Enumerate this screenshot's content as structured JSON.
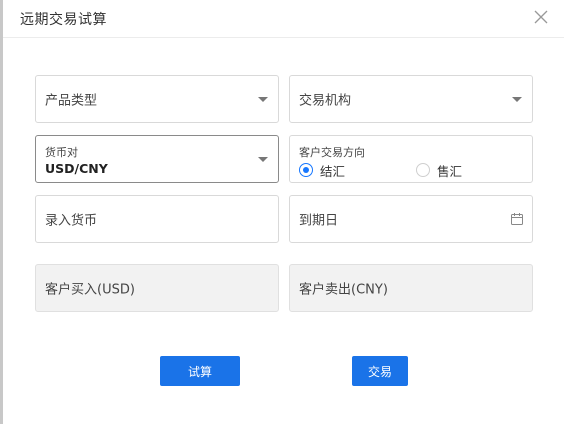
{
  "dialog": {
    "title": "远期交易试算",
    "close_icon": "close-icon"
  },
  "form": {
    "product_type": {
      "placeholder": "产品类型"
    },
    "trading_institution": {
      "placeholder": "交易机构"
    },
    "currency_pair": {
      "label": "货币对",
      "value": "USD/CNY"
    },
    "direction": {
      "label": "客户交易方向",
      "options": [
        {
          "label": "结汇",
          "checked": true
        },
        {
          "label": "售汇",
          "checked": false
        }
      ]
    },
    "input_currency": {
      "placeholder": "录入货币"
    },
    "maturity_date": {
      "placeholder": "到期日",
      "icon": "calendar-icon"
    },
    "customer_buy": {
      "placeholder": "客户买入(USD)"
    },
    "customer_sell": {
      "placeholder": "客户卖出(CNY)"
    }
  },
  "actions": {
    "calculate_label": "试算",
    "trade_label": "交易"
  },
  "colors": {
    "primary": "#1a73e8",
    "border": "#d9d9d9",
    "disabled_bg": "#f2f2f2"
  }
}
